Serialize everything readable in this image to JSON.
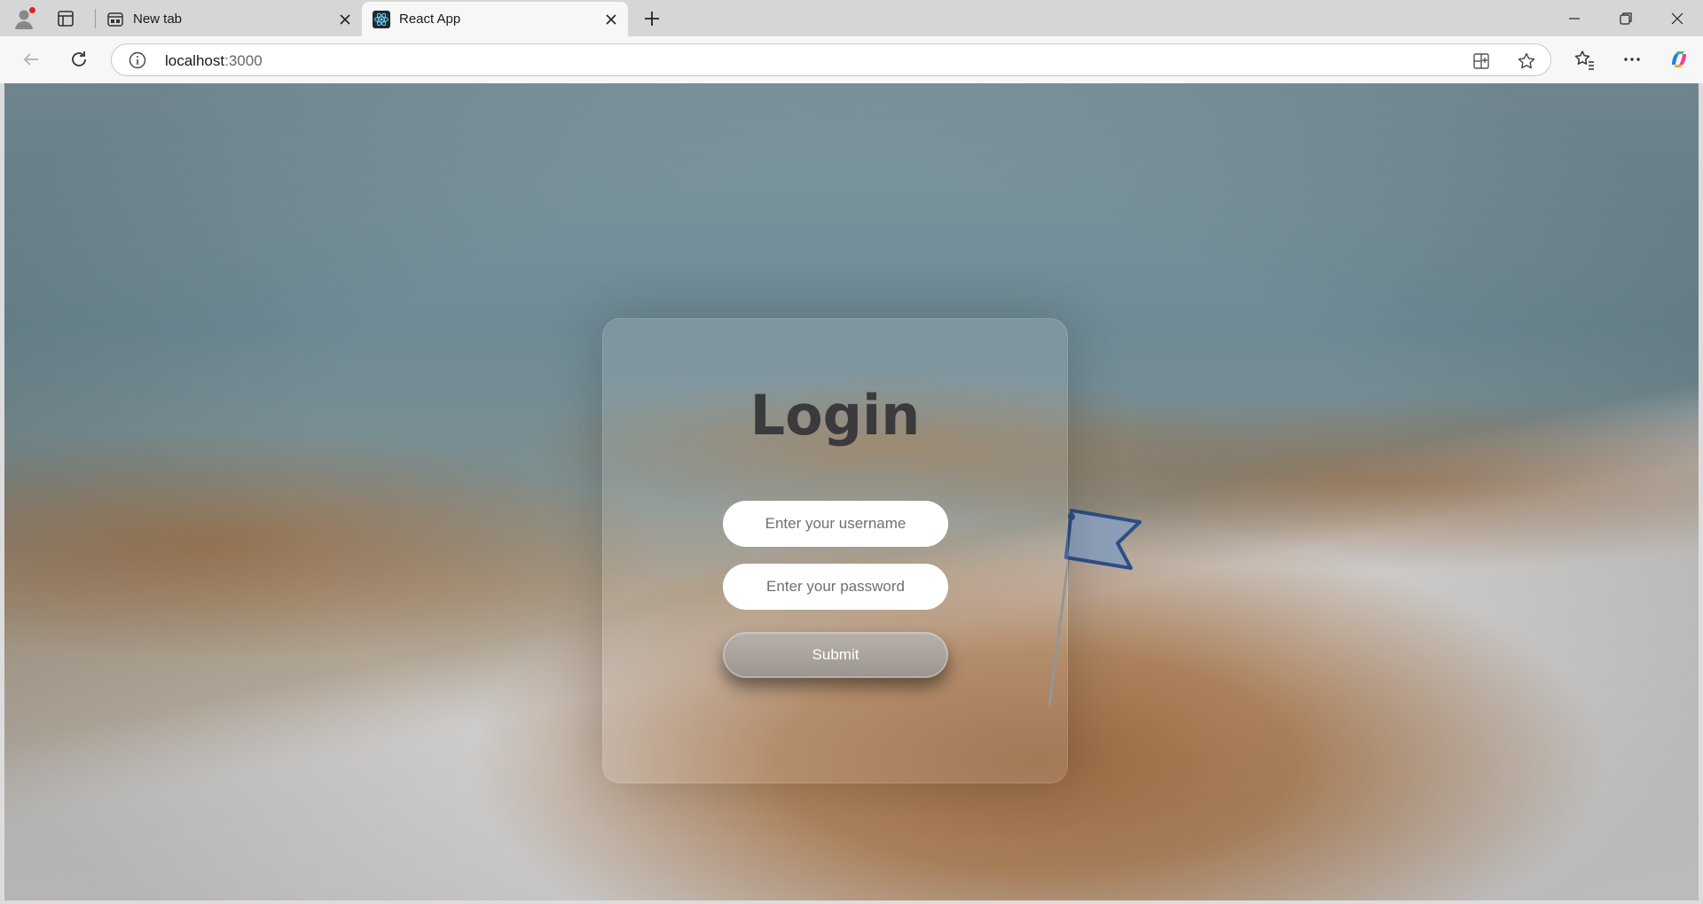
{
  "browser": {
    "tabs": [
      {
        "label": "New tab",
        "active": false
      },
      {
        "label": "React App",
        "active": true
      }
    ],
    "address": {
      "host": "localhost",
      "port": ":3000"
    }
  },
  "page": {
    "title": "Login",
    "username_placeholder": "Enter your username",
    "password_placeholder": "Enter your password",
    "submit_label": "Submit"
  },
  "colors": {
    "title": "#3b3b3d",
    "flag": "#8d9fb8"
  },
  "icons": [
    "profile-icon",
    "tab-actions-icon",
    "newtab-favicon",
    "react-favicon",
    "close-icon",
    "plus-icon",
    "minimize-icon",
    "restore-icon",
    "close-window-icon",
    "back-icon",
    "reload-icon",
    "info-icon",
    "app-available-icon",
    "favorite-star-icon",
    "favorites-icon",
    "more-icon",
    "copilot-icon"
  ]
}
